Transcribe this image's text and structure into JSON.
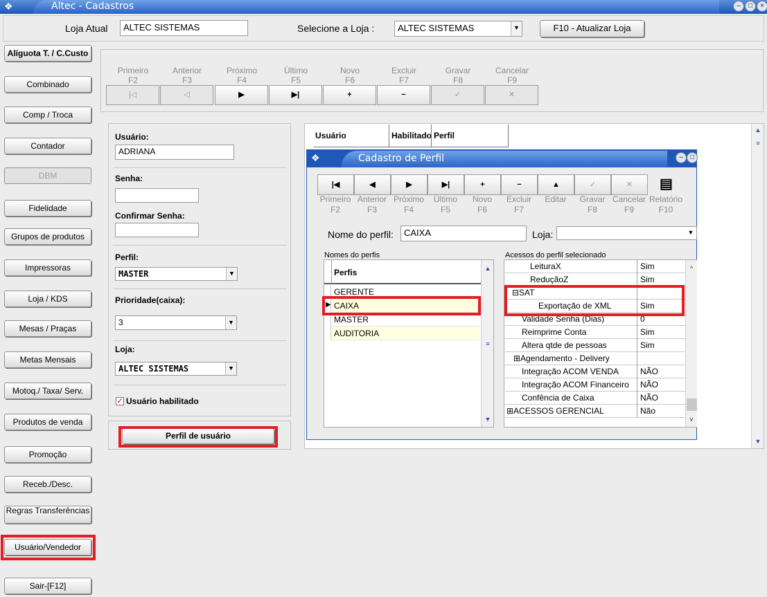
{
  "window": {
    "title": "Altec - Cadastros"
  },
  "header": {
    "loja_atual_label": "Loja Atual",
    "loja_atual_value": "ALTEC SISTEMAS",
    "selecione_loja_label": "Selecione a Loja :",
    "selecione_loja_value": "ALTEC SISTEMAS",
    "atualizar_button": "F10 - Atualizar Loja"
  },
  "sidebar": {
    "items": [
      {
        "label": "Alíguota T. / C.Custo"
      },
      {
        "label": "Combinado"
      },
      {
        "label": "Comp / Troca"
      },
      {
        "label": "Contador"
      },
      {
        "label": "DBM"
      },
      {
        "label": "Fidelidade"
      },
      {
        "label": "Grupos de produtos"
      },
      {
        "label": "Impressoras"
      },
      {
        "label": "Loja / KDS"
      },
      {
        "label": "Mesas / Praças"
      },
      {
        "label": "Metas Mensais"
      },
      {
        "label": "Motoq./ Taxa/ Serv."
      },
      {
        "label": "Produtos de venda"
      },
      {
        "label": "Promoção"
      },
      {
        "label": "Receb./Desc."
      },
      {
        "label": "Regras Transferências"
      },
      {
        "label": "Usuário/Vendedor"
      },
      {
        "label": "Sair-[F12]"
      }
    ]
  },
  "toolbar": {
    "buttons": [
      {
        "label": "Primeiro",
        "key": "F2",
        "glyph": "|◁"
      },
      {
        "label": "Anterior",
        "key": "F3",
        "glyph": "◁"
      },
      {
        "label": "Próximo",
        "key": "F4",
        "glyph": "▶"
      },
      {
        "label": "Último",
        "key": "F5",
        "glyph": "▶|"
      },
      {
        "label": "Novo",
        "key": "F6",
        "glyph": "+"
      },
      {
        "label": "Excluir",
        "key": "F7",
        "glyph": "−"
      },
      {
        "label": "Gravar",
        "key": "F8",
        "glyph": "✓"
      },
      {
        "label": "Cancelar",
        "key": "F9",
        "glyph": "✕"
      }
    ]
  },
  "form": {
    "usuario_label": "Usuário:",
    "usuario_value": "ADRIANA",
    "senha_label": "Senha:",
    "confirmar_label": "Confirmar Senha:",
    "perfil_label": "Perfil:",
    "perfil_value": "MASTER",
    "prioridade_label": "Prioridade(caixa):",
    "prioridade_value": "3",
    "loja_label": "Loja:",
    "loja_value": "ALTEC SISTEMAS",
    "habilitado_label": "Usuário habilitado",
    "perfil_usuario_button": "Perfil de usuário"
  },
  "grid": {
    "headers": [
      "Usuário",
      "Habilitado",
      "Perfil"
    ]
  },
  "perfil_dialog": {
    "title": "Cadastro de Perfil",
    "nav": [
      {
        "label": "Primeiro",
        "key": "F2",
        "glyph": "|◀"
      },
      {
        "label": "Anterior",
        "key": "F3",
        "glyph": "◀"
      },
      {
        "label": "Próximo",
        "key": "F4",
        "glyph": "▶"
      },
      {
        "label": "Último",
        "key": "F5",
        "glyph": "▶|"
      },
      {
        "label": "Novo",
        "key": "F6",
        "glyph": "+"
      },
      {
        "label": "Excluir",
        "key": "F7",
        "glyph": "−"
      },
      {
        "label": "Editar",
        "key": "",
        "glyph": "▲"
      },
      {
        "label": "Gravar",
        "key": "F8",
        "glyph": "✓"
      },
      {
        "label": "Cancelar",
        "key": "F9",
        "glyph": "✕"
      },
      {
        "label": "Relatório",
        "key": "F10",
        "glyph": "▤"
      }
    ],
    "nome_label": "Nome do perfil:",
    "nome_value": "CAIXA",
    "loja_label": "Loja:",
    "loja_value": "",
    "nomes_label": "Nomes do perfis",
    "perfis_header": "Perfis",
    "perfis": [
      "GERENTE",
      "CAIXA",
      "MASTER",
      "AUDITORIA"
    ],
    "acessos_label": "Acessos do perfil selecionado",
    "acessos": [
      {
        "name": "LeituraX",
        "value": "Sim"
      },
      {
        "name": "ReduçãoZ",
        "value": "Sim"
      },
      {
        "name": "⊟SAT",
        "value": ""
      },
      {
        "name": "Exportação de XML",
        "value": "Sim"
      },
      {
        "name": "Validade Senha (Dias)",
        "value": "0"
      },
      {
        "name": "Reimprime Conta",
        "value": "Sim"
      },
      {
        "name": "Altera qtde de pessoas",
        "value": "Sim"
      },
      {
        "name": "⊞Agendamento - Delivery",
        "value": ""
      },
      {
        "name": "Integração ACOM VENDA",
        "value": "NÃO"
      },
      {
        "name": "Integração ACOM Financeiro",
        "value": "NÃO"
      },
      {
        "name": "Confência de Caixa",
        "value": "NÃO"
      },
      {
        "name": "⊞ACESSOS GERENCIAL",
        "value": "Não"
      }
    ]
  }
}
